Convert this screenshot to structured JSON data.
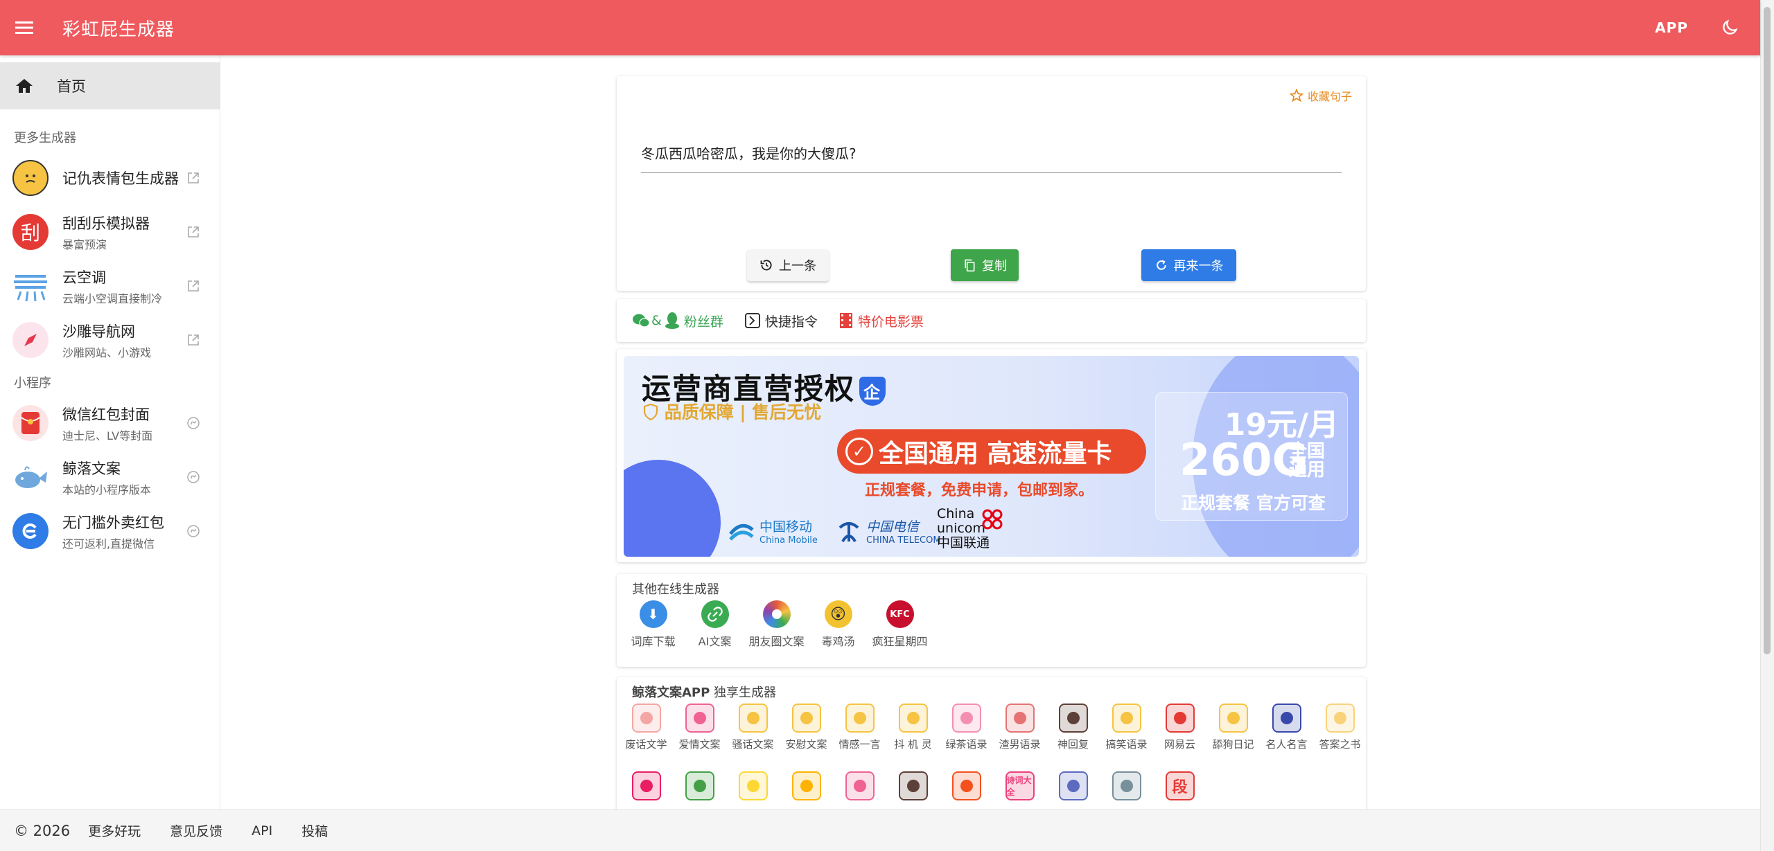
{
  "header": {
    "title": "彩虹屁生成器",
    "app_button": "APP",
    "bg_color": "#EE5A5E"
  },
  "sidebar": {
    "home_label": "首页",
    "section_more": "更多生成器",
    "section_mini": "小程序",
    "more_items": [
      {
        "title": "记仇表情包生成器",
        "subtitle": ""
      },
      {
        "title": "刮刮乐模拟器",
        "subtitle": "暴富预演"
      },
      {
        "title": "云空调",
        "subtitle": "云端小空调直接制冷"
      },
      {
        "title": "沙雕导航网",
        "subtitle": "沙雕网站、小游戏"
      }
    ],
    "mini_items": [
      {
        "title": "微信红包封面",
        "subtitle": "迪士尼、LV等封面"
      },
      {
        "title": "鲸落文案",
        "subtitle": "本站的小程序版本"
      },
      {
        "title": "无门槛外卖红包",
        "subtitle": "还可返利,直提微信"
      }
    ]
  },
  "quote_card": {
    "favorite_label": "收藏句子",
    "text": "冬瓜西瓜哈密瓜，我是你的大傻瓜?",
    "prev_label": "上一条",
    "copy_label": "复制",
    "next_label": "再来一条"
  },
  "links": {
    "fans_sep": "&",
    "fans_label": "粉丝群",
    "shortcut_label": "快捷指令",
    "movie_label": "特价电影票"
  },
  "banner": {
    "title": "运营商直营授权",
    "badge": "企",
    "subtitle": "品质保障 | 售后无忧",
    "pill": "全国通用 高速流量卡",
    "note": "正规套餐，免费申请，包邮到家。",
    "price": "19元/月",
    "gb": "260G",
    "gb_side": [
      "全国",
      "通用"
    ],
    "gb_note": "正规套餐 官方可查",
    "logos": [
      {
        "name": "中国移动",
        "en": "China Mobile"
      },
      {
        "name": "中国电信",
        "en": "CHINA TELECOM"
      },
      {
        "name": "China unicom中国联通",
        "en": ""
      }
    ]
  },
  "other_generators": {
    "title": "其他在线生成器",
    "items": [
      {
        "label": "词库下载",
        "icon": "download-icon",
        "color": "#3B8EE5"
      },
      {
        "label": "AI文案",
        "icon": "link-icon",
        "color": "#3AAB52"
      },
      {
        "label": "朋友圈文案",
        "icon": "aperture-icon",
        "color": "#E25B3C"
      },
      {
        "label": "毒鸡汤",
        "icon": "poison-face-icon",
        "color": "#F2C230"
      },
      {
        "label": "疯狂星期四",
        "icon": "kfc-icon",
        "color": "#C8102E"
      }
    ]
  },
  "app_generators": {
    "title_bold": "鲸落文案APP",
    "title_rest": " 独享生成器",
    "row1": [
      {
        "label": "废话文学",
        "icon": "brain-icon",
        "color": "#F3A6A3"
      },
      {
        "label": "爱情文案",
        "icon": "heart-icon",
        "color": "#F06292"
      },
      {
        "label": "骚话文案",
        "icon": "star-eyes-icon",
        "color": "#F6C342"
      },
      {
        "label": "安慰文案",
        "icon": "comfort-face-icon",
        "color": "#F6C342"
      },
      {
        "label": "情感一言",
        "icon": "smile-face-icon",
        "color": "#F6C342"
      },
      {
        "label": "抖 机 灵",
        "icon": "cool-face-icon",
        "color": "#F6C342"
      },
      {
        "label": "绿茶语录",
        "icon": "tea-heart-icon",
        "color": "#F48FB1"
      },
      {
        "label": "渣男语录",
        "icon": "pulse-heart-icon",
        "color": "#E57373"
      },
      {
        "label": "神回复",
        "icon": "message-icon",
        "color": "#5D4037"
      },
      {
        "label": "搞笑语录",
        "icon": "smirk-face-icon",
        "color": "#F6C342"
      },
      {
        "label": "网易云",
        "icon": "netease-icon",
        "color": "#E53935"
      },
      {
        "label": "舔狗日记",
        "icon": "tongue-face-icon",
        "color": "#F6C342"
      },
      {
        "label": "名人名言",
        "icon": "graduate-icon",
        "color": "#3949AB"
      },
      {
        "label": "答案之书",
        "icon": "book-icon",
        "color": "#F9D27A"
      }
    ],
    "row2": [
      {
        "icon": "chat-app-icon",
        "color": "#E91E63"
      },
      {
        "icon": "notebook-icon",
        "color": "#43A047"
      },
      {
        "icon": "speech-icon",
        "color": "#FDD835"
      },
      {
        "icon": "bulb-icon",
        "color": "#FFB300"
      },
      {
        "icon": "pencil-icon",
        "color": "#F06292"
      },
      {
        "icon": "gamepad-icon",
        "color": "#5D4037"
      },
      {
        "icon": "dice-icon",
        "color": "#F4511E"
      },
      {
        "icon": "poetry-icon",
        "color": "#EC407A",
        "text": "诗词大全"
      },
      {
        "icon": "people-icon",
        "color": "#5C6BC0"
      },
      {
        "icon": "dialog-icon",
        "color": "#78909C"
      },
      {
        "icon": "segment-icon",
        "color": "#E53935",
        "text": "段"
      }
    ]
  },
  "footer": {
    "copyright": "© 2026",
    "links": [
      "更多好玩",
      "意见反馈",
      "API",
      "投稿"
    ]
  }
}
